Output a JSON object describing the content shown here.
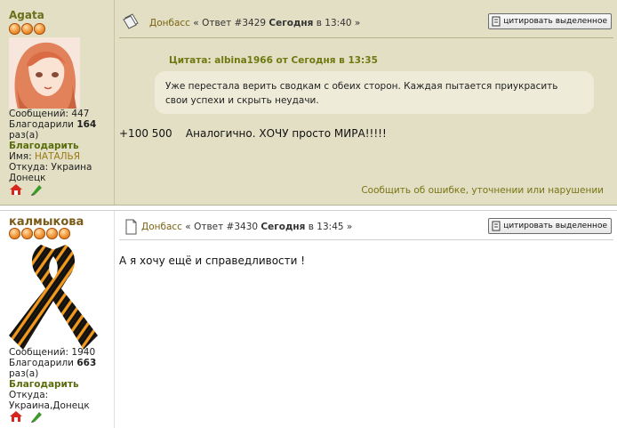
{
  "posts": [
    {
      "username": "Agata",
      "stars": 3,
      "avatar": "anime-girl-avatar",
      "stats": {
        "messages_label": "Сообщений:",
        "messages": "447",
        "thanked_label": "Благодарили",
        "thanked": "164",
        "thanked_suffix": "раз(а)",
        "thank_link": "Благодарить",
        "name_label": "Имя:",
        "name": "НАТАЛЬЯ",
        "from_label": "Откуда:",
        "from": "Украина Донецк"
      },
      "header": {
        "forum": "Донбасс",
        "sep_left": " « ",
        "answer": "Ответ #3429",
        "today": "Сегодня",
        "time": " в 13:40 »",
        "quote_button": "цитировать выделенное"
      },
      "quote": {
        "head": "Цитата: albina1966 от Сегодня в 13:35",
        "text": "Уже перестала верить сводкам с обеих сторон. Каждая пытается приукрасить свои успехи и скрыть неудачи."
      },
      "message": "+100 500    Аналогично. ХОЧУ просто МИРА!!!!!",
      "report": "Сообщить об ошибке, уточнении или нарушении"
    },
    {
      "username": "калмыкова",
      "stars": 5,
      "avatar": "st-george-ribbon-avatar",
      "stats": {
        "messages_label": "Сообщений:",
        "messages": "1940",
        "thanked_label": "Благодарили",
        "thanked": "663",
        "thanked_suffix": "раз(а)",
        "thank_link": "Благодарить",
        "from_label": "Откуда:",
        "from": "Украина,Донецк"
      },
      "header": {
        "forum": "Донбасс",
        "sep_left": " « ",
        "answer": "Ответ #3430",
        "today": "Сегодня",
        "time": " в 13:45 »",
        "quote_button": "цитировать выделенное"
      },
      "message": "А я хочу ещё и справедливости !"
    }
  ],
  "icons": {
    "home": "home-icon",
    "status": "online-status-icon",
    "post_doc": "post-document-icon",
    "quote_btn": "quote-icon"
  },
  "colors": {
    "post1_bg": "#e2dfc4",
    "quote_bg": "#eeecd9",
    "accent": "#6b6f1a",
    "link": "#7a6412"
  }
}
